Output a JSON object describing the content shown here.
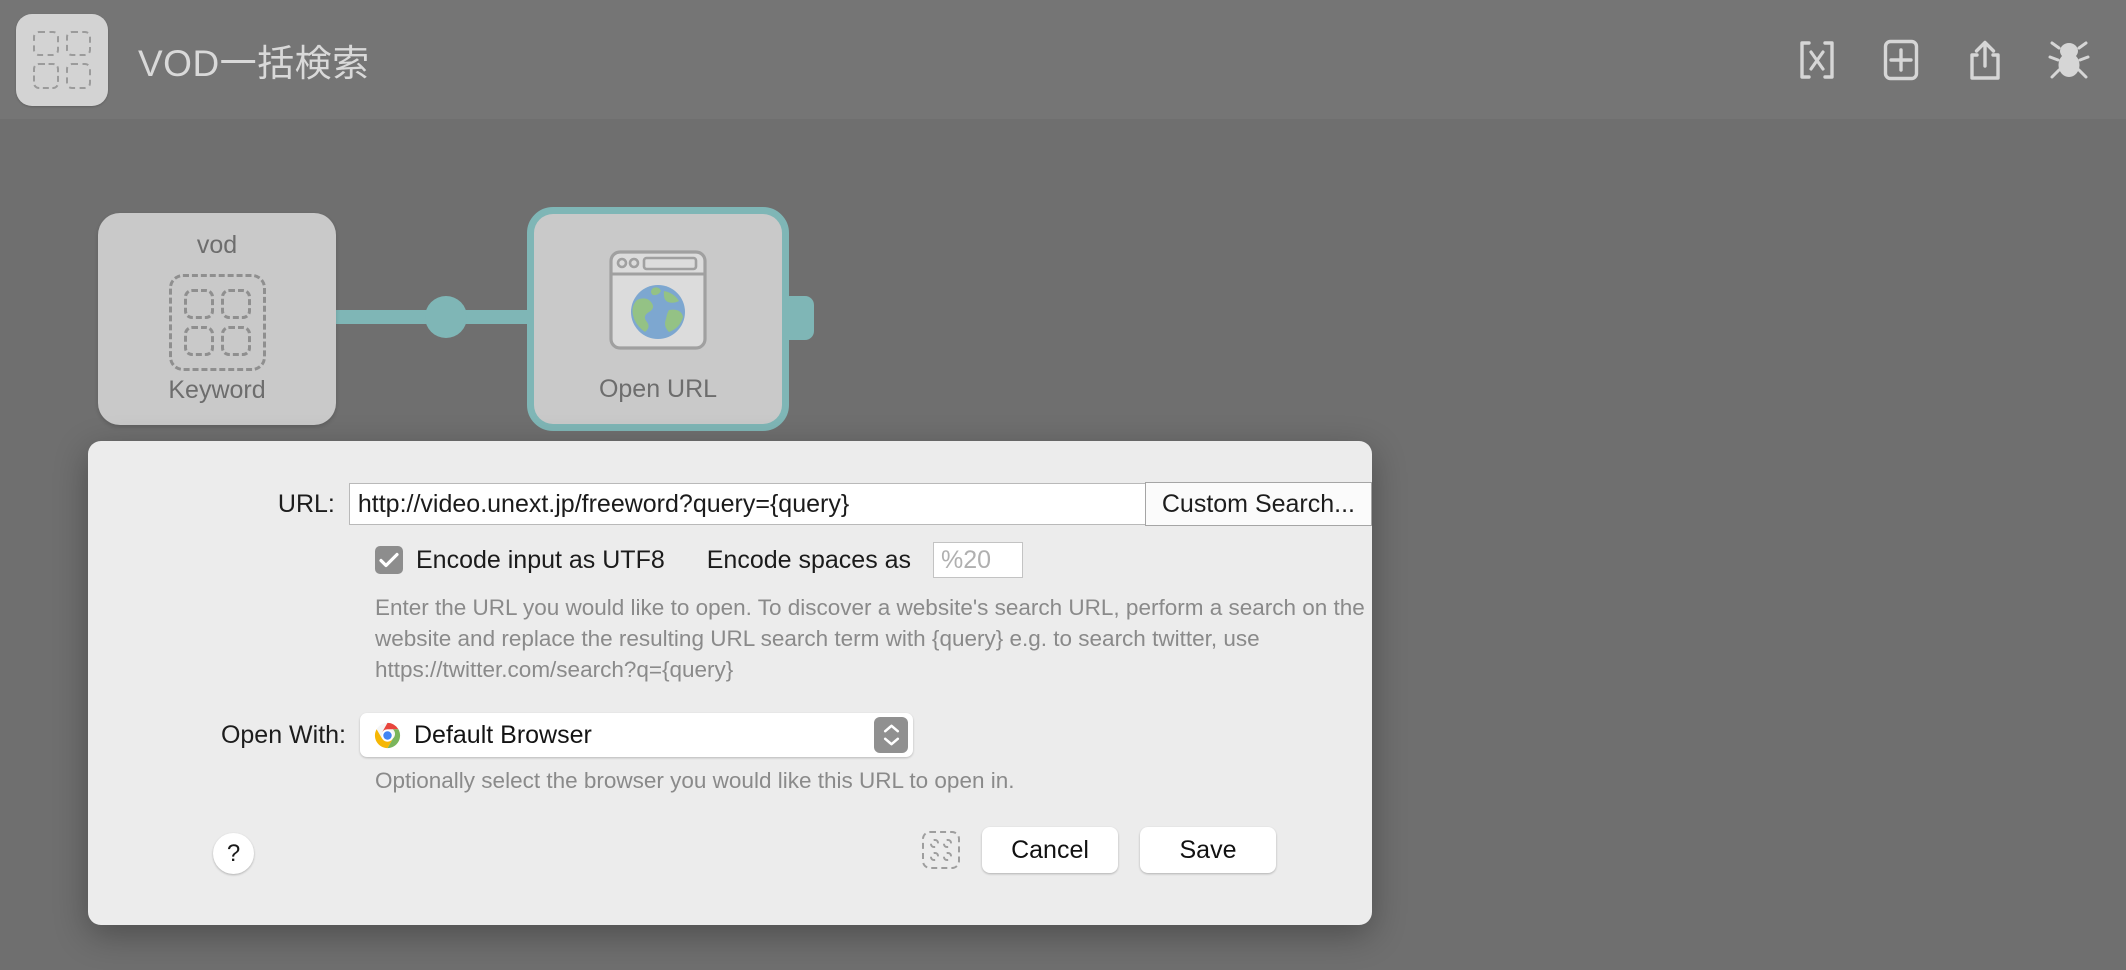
{
  "toolbar": {
    "workflow_icon": "shortcut-grid-icon",
    "title": "VOD一括検索",
    "buttons": [
      {
        "name": "variables-icon",
        "label": "[x]"
      },
      {
        "name": "add-action-icon",
        "label": "+"
      },
      {
        "name": "share-icon",
        "label": "Share"
      },
      {
        "name": "debug-bug-icon",
        "label": "Debug"
      }
    ]
  },
  "canvas": {
    "nodes": [
      {
        "top_label": "vod",
        "bottom_label": "Keyword",
        "icon": "shortcut-grid-icon",
        "selected": false
      },
      {
        "top_label": "",
        "bottom_label": "Open URL",
        "icon": "browser-globe-icon",
        "selected": true
      }
    ],
    "connector_color": "#7fb6b6",
    "selection_color": "#7fb6b6",
    "node_fill": "#c9c9c9",
    "background": "#6f6f6f"
  },
  "dialog": {
    "url": {
      "label": "URL:",
      "value": "http://video.unext.jp/freeword?query={query}",
      "placeholder": "",
      "custom_search_button": "Custom Search..."
    },
    "encode": {
      "checkbox_label": "Encode input as UTF8",
      "checkbox_checked": true,
      "spaces_label": "Encode spaces as",
      "spaces_value": "",
      "spaces_placeholder": "%20"
    },
    "url_help": "Enter the URL you would like to open. To discover a website's search URL, perform a search on the website and replace the resulting URL search term with {query} e.g. to search twitter, use https://twitter.com/search?q={query}",
    "open_with": {
      "label": "Open With:",
      "selected": "Default Browser",
      "icon": "chrome-icon",
      "note": "Optionally select the browser you would like this URL to open in."
    },
    "footer": {
      "help": "?",
      "shortcut_icon": "shortcut-grid-icon",
      "cancel": "Cancel",
      "save": "Save"
    }
  }
}
